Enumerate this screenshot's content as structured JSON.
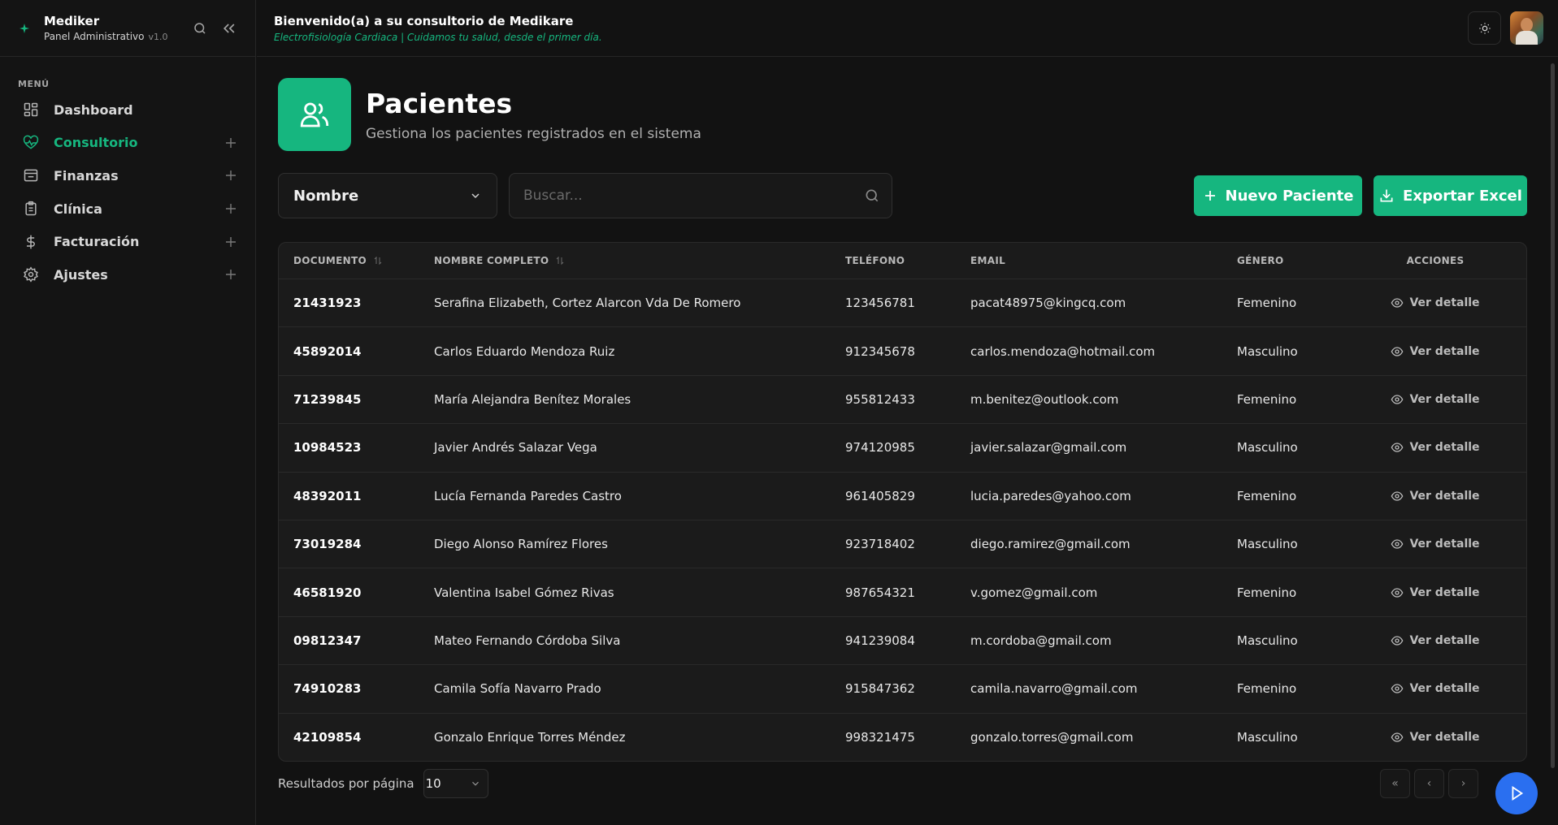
{
  "brand": {
    "name": "Mediker",
    "subtitle": "Panel Administrativo",
    "version": "v1.0"
  },
  "menu": {
    "label": "MENÚ",
    "items": [
      {
        "label": "Dashboard",
        "icon": "dashboard-icon",
        "active": false,
        "expandable": false
      },
      {
        "label": "Consultorio",
        "icon": "heart-pulse-icon",
        "active": true,
        "expandable": true
      },
      {
        "label": "Finanzas",
        "icon": "wallet-icon",
        "active": false,
        "expandable": true
      },
      {
        "label": "Clínica",
        "icon": "clipboard-icon",
        "active": false,
        "expandable": true
      },
      {
        "label": "Facturación",
        "icon": "dollar-icon",
        "active": false,
        "expandable": true
      },
      {
        "label": "Ajustes",
        "icon": "settings-icon",
        "active": false,
        "expandable": true
      }
    ]
  },
  "header": {
    "welcome": "Bienvenido(a) a su consultorio de Medikare",
    "tagline": "Electrofisiología Cardiaca | Cuidamos tu salud, desde el primer día."
  },
  "page": {
    "title": "Pacientes",
    "subtitle": "Gestiona los pacientes registrados en el sistema"
  },
  "filters": {
    "field": "Nombre",
    "search_placeholder": "Buscar..."
  },
  "actions": {
    "new_patient": "Nuevo Paciente",
    "export": "Exportar Excel"
  },
  "table": {
    "columns": [
      "DOCUMENTO",
      "NOMBRE COMPLETO",
      "TELÉFONO",
      "EMAIL",
      "GÉNERO",
      "ACCIONES"
    ],
    "action_label": "Ver detalle",
    "rows": [
      {
        "doc": "21431923",
        "name": "Serafina Elizabeth, Cortez Alarcon Vda De Romero",
        "phone": "123456781",
        "email": "pacat48975@kingcq.com",
        "gender": "Femenino"
      },
      {
        "doc": "45892014",
        "name": "Carlos Eduardo Mendoza Ruiz",
        "phone": "912345678",
        "email": "carlos.mendoza@hotmail.com",
        "gender": "Masculino"
      },
      {
        "doc": "71239845",
        "name": "María Alejandra Benítez Morales",
        "phone": "955812433",
        "email": "m.benitez@outlook.com",
        "gender": "Femenino"
      },
      {
        "doc": "10984523",
        "name": "Javier Andrés Salazar Vega",
        "phone": "974120985",
        "email": "javier.salazar@gmail.com",
        "gender": "Masculino"
      },
      {
        "doc": "48392011",
        "name": "Lucía Fernanda Paredes Castro",
        "phone": "961405829",
        "email": "lucia.paredes@yahoo.com",
        "gender": "Femenino"
      },
      {
        "doc": "73019284",
        "name": "Diego Alonso Ramírez Flores",
        "phone": "923718402",
        "email": "diego.ramirez@gmail.com",
        "gender": "Masculino"
      },
      {
        "doc": "46581920",
        "name": "Valentina Isabel Gómez Rivas",
        "phone": "987654321",
        "email": "v.gomez@gmail.com",
        "gender": "Femenino"
      },
      {
        "doc": "09812347",
        "name": "Mateo Fernando Córdoba Silva",
        "phone": "941239084",
        "email": "m.cordoba@gmail.com",
        "gender": "Masculino"
      },
      {
        "doc": "74910283",
        "name": "Camila Sofía Navarro Prado",
        "phone": "915847362",
        "email": "camila.navarro@gmail.com",
        "gender": "Femenino"
      },
      {
        "doc": "42109854",
        "name": "Gonzalo Enrique Torres Méndez",
        "phone": "998321475",
        "email": "gonzalo.torres@gmail.com",
        "gender": "Masculino"
      }
    ]
  },
  "pagination": {
    "label": "Resultados por página",
    "page_size": "10",
    "first": "«",
    "prev": "‹",
    "next": "›"
  },
  "colors": {
    "accent": "#16b67f",
    "fab": "#2a6ff0",
    "background": "#121212"
  }
}
